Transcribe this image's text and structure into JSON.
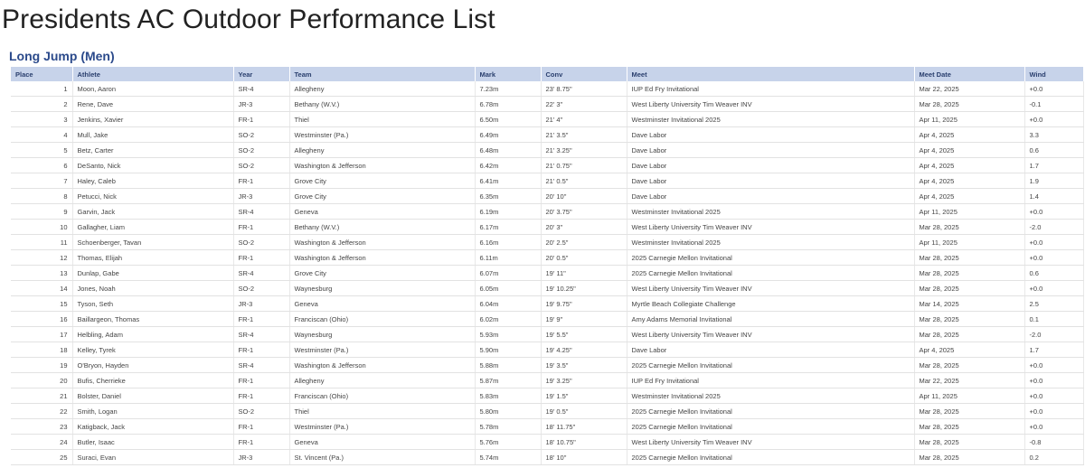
{
  "page": {
    "title": "Presidents AC Outdoor Performance List",
    "section_title": "Long Jump (Men)"
  },
  "table": {
    "headers": {
      "place": "Place",
      "athlete": "Athlete",
      "year": "Year",
      "team": "Team",
      "mark": "Mark",
      "conv": "Conv",
      "meet": "Meet",
      "meet_date": "Meet Date",
      "wind": "Wind"
    },
    "rows": [
      {
        "place": "1",
        "athlete": "Moon, Aaron",
        "year": "SR-4",
        "team": "Allegheny",
        "mark": "7.23m",
        "conv": "23' 8.75\"",
        "meet": "IUP Ed Fry Invitational",
        "meet_date": "Mar 22, 2025",
        "wind": "+0.0"
      },
      {
        "place": "2",
        "athlete": "Rene, Dave",
        "year": "JR-3",
        "team": "Bethany (W.V.)",
        "mark": "6.78m",
        "conv": "22' 3\"",
        "meet": "West Liberty University Tim Weaver INV",
        "meet_date": "Mar 28, 2025",
        "wind": "-0.1"
      },
      {
        "place": "3",
        "athlete": "Jenkins, Xavier",
        "year": "FR-1",
        "team": "Thiel",
        "mark": "6.50m",
        "conv": "21' 4\"",
        "meet": "Westminster Invitational 2025",
        "meet_date": "Apr 11, 2025",
        "wind": "+0.0"
      },
      {
        "place": "4",
        "athlete": "Mull, Jake",
        "year": "SO-2",
        "team": "Westminster (Pa.)",
        "mark": "6.49m",
        "conv": "21' 3.5\"",
        "meet": "Dave Labor",
        "meet_date": "Apr 4, 2025",
        "wind": "3.3"
      },
      {
        "place": "5",
        "athlete": "Betz, Carter",
        "year": "SO-2",
        "team": "Allegheny",
        "mark": "6.48m",
        "conv": "21' 3.25\"",
        "meet": "Dave Labor",
        "meet_date": "Apr 4, 2025",
        "wind": "0.6"
      },
      {
        "place": "6",
        "athlete": "DeSanto, Nick",
        "year": "SO-2",
        "team": "Washington & Jefferson",
        "mark": "6.42m",
        "conv": "21' 0.75\"",
        "meet": "Dave Labor",
        "meet_date": "Apr 4, 2025",
        "wind": "1.7"
      },
      {
        "place": "7",
        "athlete": "Haley, Caleb",
        "year": "FR-1",
        "team": "Grove City",
        "mark": "6.41m",
        "conv": "21' 0.5\"",
        "meet": "Dave Labor",
        "meet_date": "Apr 4, 2025",
        "wind": "1.9"
      },
      {
        "place": "8",
        "athlete": "Petucci, Nick",
        "year": "JR-3",
        "team": "Grove City",
        "mark": "6.35m",
        "conv": "20' 10\"",
        "meet": "Dave Labor",
        "meet_date": "Apr 4, 2025",
        "wind": "1.4"
      },
      {
        "place": "9",
        "athlete": "Garvin, Jack",
        "year": "SR-4",
        "team": "Geneva",
        "mark": "6.19m",
        "conv": "20' 3.75\"",
        "meet": "Westminster Invitational 2025",
        "meet_date": "Apr 11, 2025",
        "wind": "+0.0"
      },
      {
        "place": "10",
        "athlete": "Gallagher, Liam",
        "year": "FR-1",
        "team": "Bethany (W.V.)",
        "mark": "6.17m",
        "conv": "20' 3\"",
        "meet": "West Liberty University Tim Weaver INV",
        "meet_date": "Mar 28, 2025",
        "wind": "-2.0"
      },
      {
        "place": "11",
        "athlete": "Schoenberger, Tavan",
        "year": "SO-2",
        "team": "Washington & Jefferson",
        "mark": "6.16m",
        "conv": "20' 2.5\"",
        "meet": "Westminster Invitational 2025",
        "meet_date": "Apr 11, 2025",
        "wind": "+0.0"
      },
      {
        "place": "12",
        "athlete": "Thomas, Elijah",
        "year": "FR-1",
        "team": "Washington & Jefferson",
        "mark": "6.11m",
        "conv": "20' 0.5\"",
        "meet": "2025 Carnegie Mellon Invitational",
        "meet_date": "Mar 28, 2025",
        "wind": "+0.0"
      },
      {
        "place": "13",
        "athlete": "Dunlap, Gabe",
        "year": "SR-4",
        "team": "Grove City",
        "mark": "6.07m",
        "conv": "19' 11\"",
        "meet": "2025 Carnegie Mellon Invitational",
        "meet_date": "Mar 28, 2025",
        "wind": "0.6"
      },
      {
        "place": "14",
        "athlete": "Jones, Noah",
        "year": "SO-2",
        "team": "Waynesburg",
        "mark": "6.05m",
        "conv": "19' 10.25\"",
        "meet": "West Liberty University Tim Weaver INV",
        "meet_date": "Mar 28, 2025",
        "wind": "+0.0"
      },
      {
        "place": "15",
        "athlete": "Tyson, Seth",
        "year": "JR-3",
        "team": "Geneva",
        "mark": "6.04m",
        "conv": "19' 9.75\"",
        "meet": "Myrtle Beach Collegiate Challenge",
        "meet_date": "Mar 14, 2025",
        "wind": "2.5"
      },
      {
        "place": "16",
        "athlete": "Baillargeon, Thomas",
        "year": "FR-1",
        "team": "Franciscan (Ohio)",
        "mark": "6.02m",
        "conv": "19' 9\"",
        "meet": "Amy Adams Memorial Invitational",
        "meet_date": "Mar 28, 2025",
        "wind": "0.1"
      },
      {
        "place": "17",
        "athlete": "Helbling, Adam",
        "year": "SR-4",
        "team": "Waynesburg",
        "mark": "5.93m",
        "conv": "19' 5.5\"",
        "meet": "West Liberty University Tim Weaver INV",
        "meet_date": "Mar 28, 2025",
        "wind": "-2.0"
      },
      {
        "place": "18",
        "athlete": "Kelley, Tyrek",
        "year": "FR-1",
        "team": "Westminster (Pa.)",
        "mark": "5.90m",
        "conv": "19' 4.25\"",
        "meet": "Dave Labor",
        "meet_date": "Apr 4, 2025",
        "wind": "1.7"
      },
      {
        "place": "19",
        "athlete": "O'Bryon, Hayden",
        "year": "SR-4",
        "team": "Washington & Jefferson",
        "mark": "5.88m",
        "conv": "19' 3.5\"",
        "meet": "2025 Carnegie Mellon Invitational",
        "meet_date": "Mar 28, 2025",
        "wind": "+0.0"
      },
      {
        "place": "20",
        "athlete": "Bufis, Cherrieke",
        "year": "FR-1",
        "team": "Allegheny",
        "mark": "5.87m",
        "conv": "19' 3.25\"",
        "meet": "IUP Ed Fry Invitational",
        "meet_date": "Mar 22, 2025",
        "wind": "+0.0"
      },
      {
        "place": "21",
        "athlete": "Bolster, Daniel",
        "year": "FR-1",
        "team": "Franciscan (Ohio)",
        "mark": "5.83m",
        "conv": "19' 1.5\"",
        "meet": "Westminster Invitational 2025",
        "meet_date": "Apr 11, 2025",
        "wind": "+0.0"
      },
      {
        "place": "22",
        "athlete": "Smith, Logan",
        "year": "SO-2",
        "team": "Thiel",
        "mark": "5.80m",
        "conv": "19' 0.5\"",
        "meet": "2025 Carnegie Mellon Invitational",
        "meet_date": "Mar 28, 2025",
        "wind": "+0.0"
      },
      {
        "place": "23",
        "athlete": "Katigback, Jack",
        "year": "FR-1",
        "team": "Westminster (Pa.)",
        "mark": "5.78m",
        "conv": "18' 11.75\"",
        "meet": "2025 Carnegie Mellon Invitational",
        "meet_date": "Mar 28, 2025",
        "wind": "+0.0"
      },
      {
        "place": "24",
        "athlete": "Butler, Isaac",
        "year": "FR-1",
        "team": "Geneva",
        "mark": "5.76m",
        "conv": "18' 10.75\"",
        "meet": "West Liberty University Tim Weaver INV",
        "meet_date": "Mar 28, 2025",
        "wind": "-0.8"
      },
      {
        "place": "25",
        "athlete": "Suraci, Evan",
        "year": "JR-3",
        "team": "St. Vincent (Pa.)",
        "mark": "5.74m",
        "conv": "18' 10\"",
        "meet": "2025 Carnegie Mellon Invitational",
        "meet_date": "Mar 28, 2025",
        "wind": "0.2"
      }
    ]
  }
}
